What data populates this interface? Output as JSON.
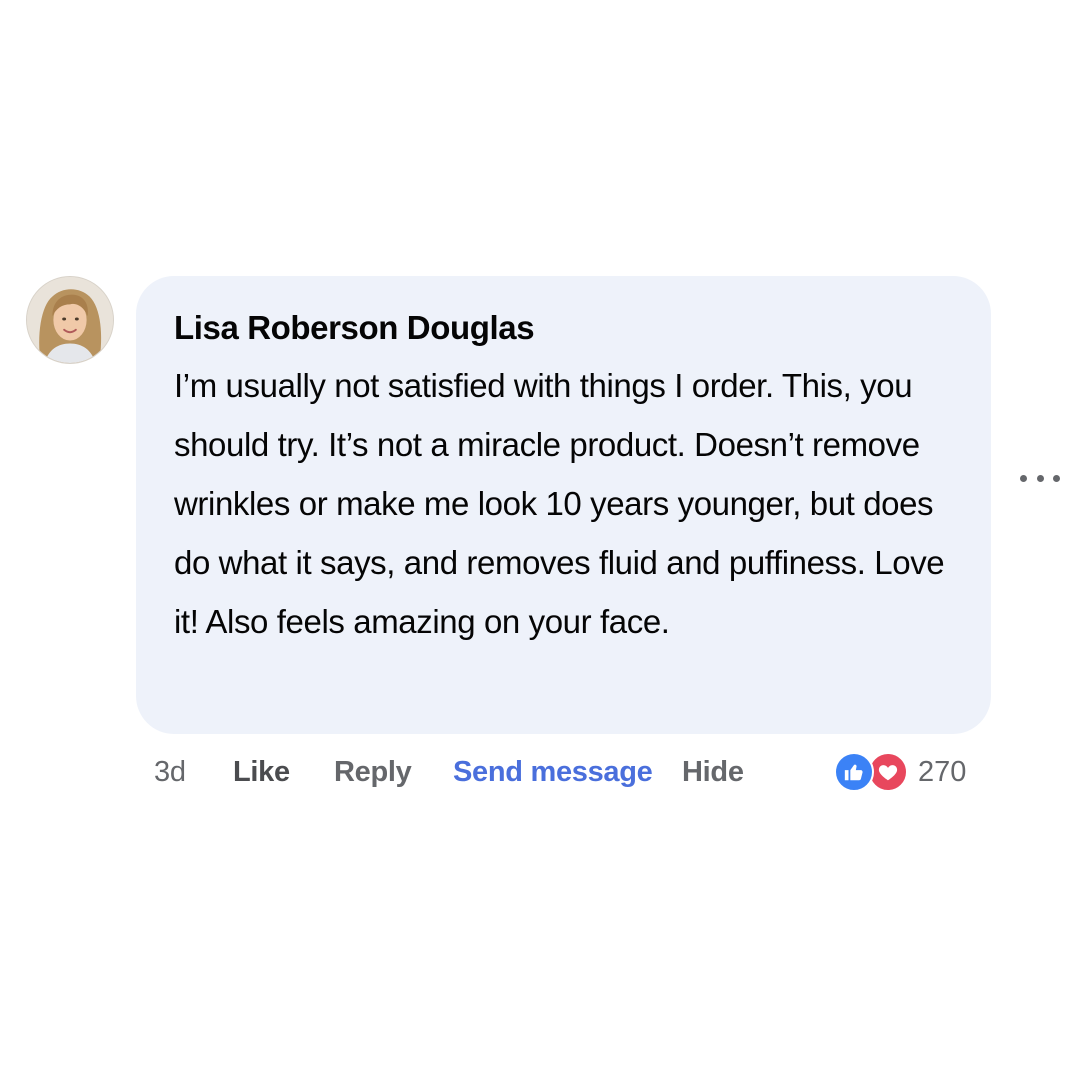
{
  "comment": {
    "author": "Lisa Roberson Douglas",
    "text": "I’m usually not satisfied with things I order. This, you should try. It’s not a miracle product. Doesn’t remove wrinkles or make me look 10 years younger, but does do what it says, and removes fluid and puffiness. Love it! Also feels amazing on your face.",
    "avatar_icon": "profile-photo"
  },
  "actions": {
    "time": "3d",
    "like": "Like",
    "reply": "Reply",
    "send_message": "Send message",
    "hide": "Hide"
  },
  "reactions": {
    "icons": [
      "like-icon",
      "love-icon"
    ],
    "count": "270"
  },
  "colors": {
    "bubble": "#eef2fa",
    "send_message": "#4a6fdc",
    "like_reaction": "#3b82f6",
    "love_reaction": "#e8475d",
    "muted_text": "#65676b"
  }
}
